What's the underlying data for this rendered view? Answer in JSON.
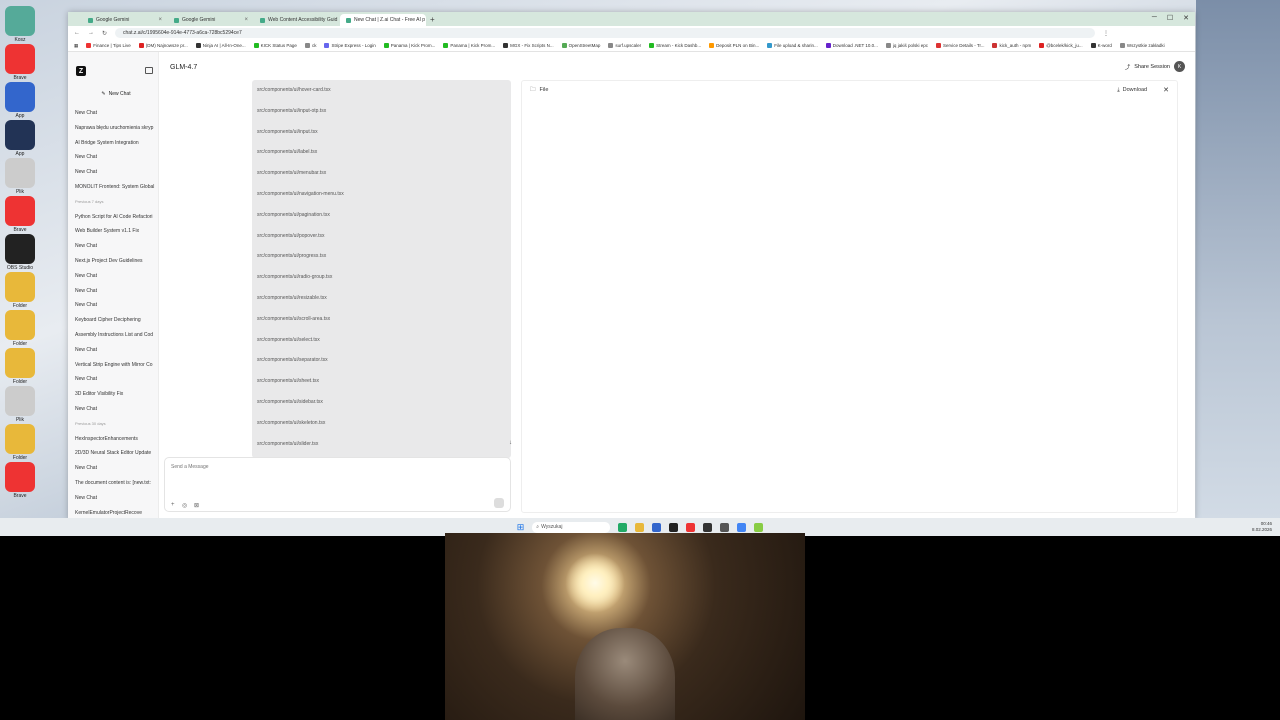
{
  "tabs": [
    {
      "label": "Google Gemini",
      "active": false
    },
    {
      "label": "Google Gemini",
      "active": false
    },
    {
      "label": "Web Content Accessibility Guid",
      "active": false
    },
    {
      "label": "New Chat | Z.ai Chat - Free AI p",
      "active": true
    }
  ],
  "address": {
    "url": "chat.z.ai/c/1995604e-914e-4773-a6ca-728bc5294ce7"
  },
  "bookmarks": [
    {
      "label": "Finance | Tips Live",
      "color": "#e33"
    },
    {
      "label": "(DM) Najnowsze pr...",
      "color": "#d22"
    },
    {
      "label": "Ninja AI | All-In-One...",
      "color": "#333"
    },
    {
      "label": "KICK Status Page",
      "color": "#2b2"
    },
    {
      "label": "ck",
      "color": "#888"
    },
    {
      "label": "Stripe Express - Login",
      "color": "#66e"
    },
    {
      "label": "Panama | Kick Prom...",
      "color": "#2b2"
    },
    {
      "label": "Panama | Kick Prom...",
      "color": "#2b2"
    },
    {
      "label": "MGX - Fix Scripts N...",
      "color": "#333"
    },
    {
      "label": "OpenStreetMap",
      "color": "#5a5"
    },
    {
      "label": "surf.upscaler",
      "color": "#888"
    },
    {
      "label": "Stream - Kick Dashb...",
      "color": "#2b2"
    },
    {
      "label": "Deposit PLN on Bin...",
      "color": "#f90"
    },
    {
      "label": "File upload & sharin...",
      "color": "#39c"
    },
    {
      "label": "Download .NET 10.0...",
      "color": "#62c"
    },
    {
      "label": "jq jakiś polski epc",
      "color": "#888"
    },
    {
      "label": "Service Details - Tr...",
      "color": "#d33"
    },
    {
      "label": "kick_auth - npm",
      "color": "#c33"
    },
    {
      "label": "@bcelek/kick_ju...",
      "color": "#d22"
    },
    {
      "label": "K-word",
      "color": "#333"
    },
    {
      "label": "Wszystkie zakładki",
      "color": "#888"
    }
  ],
  "sidebar": {
    "logo": "Z",
    "new_chat": "New Chat",
    "history": [
      {
        "label": "New Chat",
        "section": false
      },
      {
        "label": "Naprawa błędu uruchomienia skryp",
        "section": false
      },
      {
        "label": "AI Bridge System Integration",
        "section": false
      },
      {
        "label": "New Chat",
        "section": false
      },
      {
        "label": "New Chat",
        "section": false
      },
      {
        "label": "MONOLIT Frontend: System Global",
        "section": false
      },
      {
        "label": "Previous 7 days",
        "section": true
      },
      {
        "label": "Python Script for AI Code Refactori",
        "section": false
      },
      {
        "label": "Web Builder System v1.1 Fix",
        "section": false
      },
      {
        "label": "New Chat",
        "section": false
      },
      {
        "label": "Next.js Project Dev Guidelines",
        "section": false
      },
      {
        "label": "New Chat",
        "section": false
      },
      {
        "label": "New Chat",
        "section": false
      },
      {
        "label": "New Chat",
        "section": false
      },
      {
        "label": "Keyboard Cipher Deciphering",
        "section": false
      },
      {
        "label": "Assembly Instructions List and Cod",
        "section": false
      },
      {
        "label": "New Chat",
        "section": false
      },
      {
        "label": "Vertical Strip Engine with Mirror Co",
        "section": false
      },
      {
        "label": "New Chat",
        "section": false
      },
      {
        "label": "3D Editor Visibility Fix",
        "section": false
      },
      {
        "label": "New Chat",
        "section": false
      },
      {
        "label": "Previous 30 days",
        "section": true
      },
      {
        "label": "HexInspectorEnhancements",
        "section": false
      },
      {
        "label": "2D/3D Neural Stack Editor Update",
        "section": false
      },
      {
        "label": "New Chat",
        "section": false
      },
      {
        "label": "The document content is: [new.txt:",
        "section": false
      },
      {
        "label": "New Chat",
        "section": false
      },
      {
        "label": "KernelEmulatorProjectRecove",
        "section": false
      }
    ]
  },
  "main": {
    "model": "GLM-4.7",
    "share": "Share Session",
    "avatar": "K",
    "files": [
      "src/components/ui/hover-card.tsx",
      "src/components/ui/input-otp.tsx",
      "src/components/ui/input.tsx",
      "src/components/ui/label.tsx",
      "src/components/ui/menubar.tsx",
      "src/components/ui/navigation-menu.tsx",
      "src/components/ui/pagination.tsx",
      "src/components/ui/popover.tsx",
      "src/components/ui/progress.tsx",
      "src/components/ui/radio-group.tsx",
      "src/components/ui/resizable.tsx",
      "src/components/ui/scroll-area.tsx",
      "src/components/ui/select.tsx",
      "src/components/ui/separator.tsx",
      "src/components/ui/sheet.tsx",
      "src/components/ui/sidebar.tsx",
      "src/components/ui/skeleton.tsx",
      "src/components/ui/slider.tsx"
    ],
    "composer_placeholder": "Send a Message"
  },
  "panel": {
    "title": "File",
    "download": "Download"
  },
  "taskbar": {
    "search": "Wyszukaj",
    "time": "00:46",
    "date": "8.02.2026"
  },
  "desktop_icons": [
    {
      "label": "Kosz",
      "color": "#5a9"
    },
    {
      "label": "Brave",
      "color": "#e33"
    },
    {
      "label": "App",
      "color": "#36c"
    },
    {
      "label": "App",
      "color": "#235"
    },
    {
      "label": "Plik",
      "color": "#ccc"
    },
    {
      "label": "Brave",
      "color": "#e33"
    },
    {
      "label": "OBS Studio",
      "color": "#222"
    },
    {
      "label": "Folder",
      "color": "#e8b83a"
    },
    {
      "label": "Folder",
      "color": "#e8b83a"
    },
    {
      "label": "Folder",
      "color": "#e8b83a"
    },
    {
      "label": "Plik",
      "color": "#ccc"
    },
    {
      "label": "Folder",
      "color": "#e8b83a"
    },
    {
      "label": "Brave",
      "color": "#e33"
    }
  ]
}
